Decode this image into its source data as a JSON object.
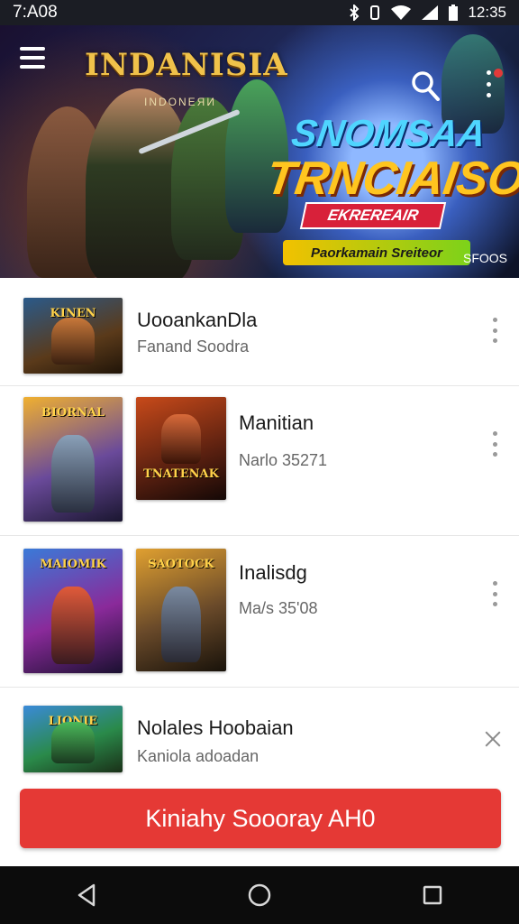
{
  "status_bar": {
    "time": "7:A08",
    "right_time": "12:35"
  },
  "hero": {
    "logo": "INDANISIA",
    "logo_sub": "INDONEЯИ",
    "title_line1": "SNOMSAA",
    "title_line2": "TRNCIAISO",
    "tag1": "EKREREAIR",
    "tag2": "Paorkamain Sreiteor",
    "corner": "SFOOS"
  },
  "list": [
    {
      "title": "UooankanDla",
      "subtitle": "Fanand Soodra",
      "thumb_caps": [
        "KINEN"
      ]
    },
    {
      "title": "Manitian",
      "subtitle": "Narlo 35271",
      "thumb_caps": [
        "BIORNAL",
        "TNATENAK"
      ]
    },
    {
      "title": "Inalisdg",
      "subtitle": "Ma/s 35'08",
      "thumb_caps": [
        "MAIOMIK",
        "SAOTOCK"
      ]
    },
    {
      "title": "Nolales Hoobaian",
      "subtitle": "Kaniola adoadan",
      "thumb_caps": [
        "LIONIE"
      ]
    }
  ],
  "cta": {
    "label": "Kiniahy Soooray AH0"
  },
  "colors": {
    "accent": "#e53935",
    "status_bar": "#1b1d24",
    "nav_bar": "#0c0c0c"
  },
  "icons": {
    "menu": "hamburger-icon",
    "search": "search-icon",
    "more": "more-vert-icon",
    "close": "close-icon",
    "back": "back-triangle-icon",
    "home": "home-circle-icon",
    "recents": "recents-square-icon"
  }
}
